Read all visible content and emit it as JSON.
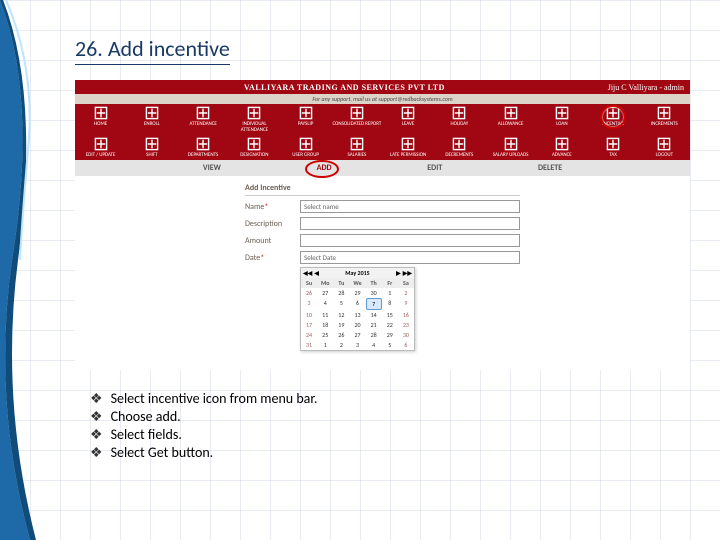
{
  "page": {
    "title_full": "26. Add incentive",
    "title_number": "26. ",
    "title_text": "Add incentive"
  },
  "app": {
    "header_left": "",
    "header_center": "VALLIYARA TRADING AND SERVICES PVT LTD",
    "header_right": "Jiju C Valliyara - admin",
    "tagline": "For any support, mail us at support@redbacksystems.com"
  },
  "nav_top": [
    {
      "label": "HOME",
      "icon": "home-icon"
    },
    {
      "label": "ENROLL",
      "icon": "enroll-icon"
    },
    {
      "label": "ATTENDANCE",
      "icon": "attendance-icon"
    },
    {
      "label": "INDIVIDUAL ATTENDANCE",
      "icon": "individual-icon"
    },
    {
      "label": "PAYSLIP",
      "icon": "payslip-icon"
    },
    {
      "label": "CONSOLIDATED REPORT",
      "icon": "report-icon"
    },
    {
      "label": "LEAVE",
      "icon": "leave-icon"
    },
    {
      "label": "HOLIDAY",
      "icon": "holiday-icon"
    },
    {
      "label": "ALLOWANCE",
      "icon": "allowance-icon"
    },
    {
      "label": "LOAN",
      "icon": "loan-icon"
    },
    {
      "label": "INCENTIVE",
      "icon": "incentive-icon",
      "circled": true
    },
    {
      "label": "INCREMENTS",
      "icon": "increments-icon"
    }
  ],
  "nav_bottom": [
    {
      "label": "EDIT / UPDATE",
      "icon": "edit-icon"
    },
    {
      "label": "SHIFT",
      "icon": "shift-icon"
    },
    {
      "label": "DEPARTMENTS",
      "icon": "departments-icon"
    },
    {
      "label": "DESIGNATION",
      "icon": "designation-icon"
    },
    {
      "label": "USER GROUP",
      "icon": "usergroup-icon"
    },
    {
      "label": "SALARIES",
      "icon": "salaries-icon"
    },
    {
      "label": "LATE PERMISSION",
      "icon": "late-icon"
    },
    {
      "label": "DECREMENTS",
      "icon": "decrements-icon"
    },
    {
      "label": "SALARY UPLOADS",
      "icon": "upload-icon"
    },
    {
      "label": "ADVANCE",
      "icon": "advance-icon"
    },
    {
      "label": "TAX",
      "icon": "tax-icon"
    },
    {
      "label": "LOGOUT",
      "icon": "logout-icon"
    }
  ],
  "actions": {
    "view": "VIEW",
    "add": "ADD",
    "edit": "EDIT",
    "delete": "DELETE"
  },
  "form": {
    "title": "Add Incentive",
    "name_label": "Name",
    "name_value": "Select name",
    "description_label": "Description",
    "description_value": "",
    "amount_label": "Amount",
    "amount_value": "",
    "date_label": "Date",
    "date_value": "Select Date"
  },
  "calendar": {
    "month_label": "May 2015",
    "prev2": "◀◀",
    "prev": "◀",
    "next": "▶",
    "next2": "▶▶",
    "dow": [
      "Su",
      "Mo",
      "Tu",
      "We",
      "Th",
      "Fr",
      "Sa"
    ],
    "weeks": [
      [
        "26",
        "27",
        "28",
        "29",
        "30",
        "1",
        "2"
      ],
      [
        "3",
        "4",
        "5",
        "6",
        "7",
        "8",
        "9"
      ],
      [
        "10",
        "11",
        "12",
        "13",
        "14",
        "15",
        "16"
      ],
      [
        "17",
        "18",
        "19",
        "20",
        "21",
        "22",
        "23"
      ],
      [
        "24",
        "25",
        "26",
        "27",
        "28",
        "29",
        "30"
      ],
      [
        "31",
        "1",
        "2",
        "3",
        "4",
        "5",
        "6"
      ]
    ],
    "today": "7"
  },
  "instructions": [
    "Select incentive icon from menu bar.",
    "Choose add.",
    "Select fields.",
    "Select Get button."
  ],
  "bullet_glyph": "❖"
}
